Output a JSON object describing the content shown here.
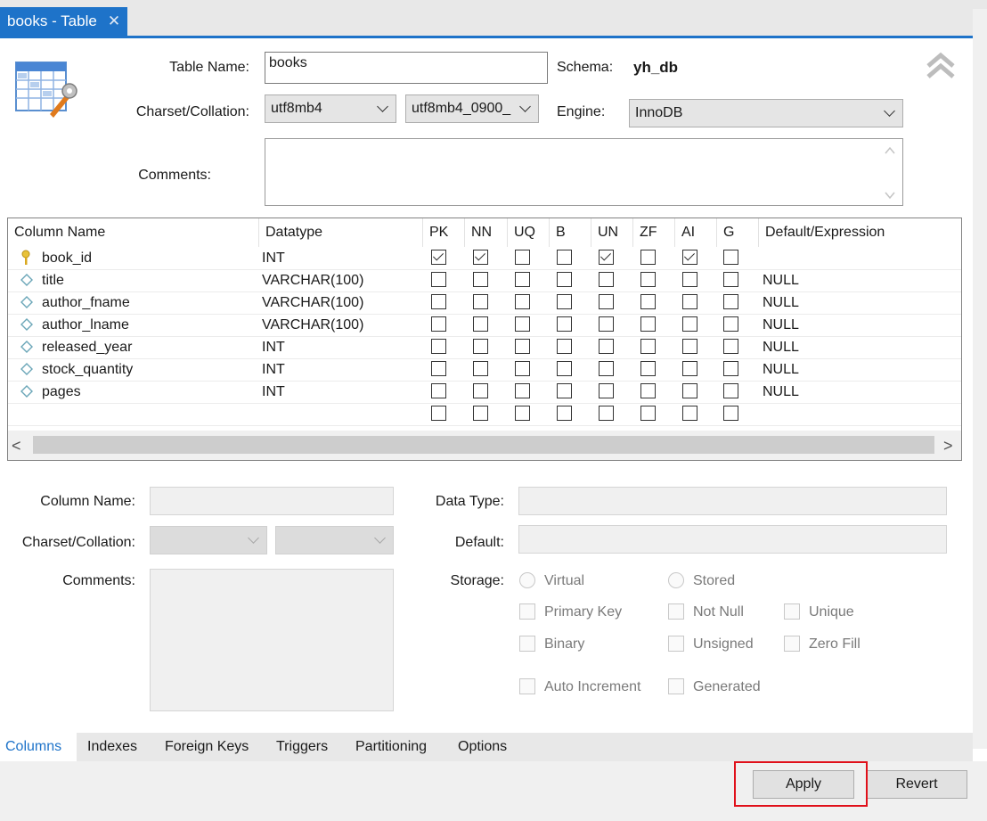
{
  "tab": {
    "title": "books - Table",
    "close_glyph": "✕"
  },
  "header": {
    "table_name_label": "Table Name:",
    "table_name_value": "books",
    "schema_label": "Schema:",
    "schema_value": "yh_db",
    "charset_label": "Charset/Collation:",
    "charset_value": "utf8mb4",
    "collation_value": "utf8mb4_0900_",
    "engine_label": "Engine:",
    "engine_value": "InnoDB",
    "comments_label": "Comments:",
    "collapse_icon": "double-chevron-up-icon",
    "table_icon": "table-wrench-icon"
  },
  "grid": {
    "headers": [
      "Column Name",
      "Datatype",
      "PK",
      "NN",
      "UQ",
      "B",
      "UN",
      "ZF",
      "AI",
      "G",
      "Default/Expression"
    ],
    "rows": [
      {
        "name": "book_id",
        "type": "INT",
        "flags": [
          true,
          true,
          false,
          false,
          true,
          false,
          true,
          false
        ],
        "default": "",
        "icon": "key-icon"
      },
      {
        "name": "title",
        "type": "VARCHAR(100)",
        "flags": [
          false,
          false,
          false,
          false,
          false,
          false,
          false,
          false
        ],
        "default": "NULL",
        "icon": "diamond-icon"
      },
      {
        "name": "author_fname",
        "type": "VARCHAR(100)",
        "flags": [
          false,
          false,
          false,
          false,
          false,
          false,
          false,
          false
        ],
        "default": "NULL",
        "icon": "diamond-icon"
      },
      {
        "name": "author_lname",
        "type": "VARCHAR(100)",
        "flags": [
          false,
          false,
          false,
          false,
          false,
          false,
          false,
          false
        ],
        "default": "NULL",
        "icon": "diamond-icon"
      },
      {
        "name": "released_year",
        "type": "INT",
        "flags": [
          false,
          false,
          false,
          false,
          false,
          false,
          false,
          false
        ],
        "default": "NULL",
        "icon": "diamond-icon"
      },
      {
        "name": "stock_quantity",
        "type": "INT",
        "flags": [
          false,
          false,
          false,
          false,
          false,
          false,
          false,
          false
        ],
        "default": "NULL",
        "icon": "diamond-icon"
      },
      {
        "name": "pages",
        "type": "INT",
        "flags": [
          false,
          false,
          false,
          false,
          false,
          false,
          false,
          false
        ],
        "default": "NULL",
        "icon": "diamond-icon"
      },
      {
        "name": "",
        "type": "",
        "flags": [
          false,
          false,
          false,
          false,
          false,
          false,
          false,
          false
        ],
        "default": "",
        "icon": ""
      }
    ],
    "scroll_left": "<",
    "scroll_right": ">"
  },
  "detail": {
    "column_name_label": "Column Name:",
    "charset_label": "Charset/Collation:",
    "comments_label": "Comments:",
    "data_type_label": "Data Type:",
    "default_label": "Default:",
    "storage_label": "Storage:",
    "virtual": "Virtual",
    "stored": "Stored",
    "primary_key": "Primary Key",
    "not_null": "Not Null",
    "unique": "Unique",
    "binary": "Binary",
    "unsigned": "Unsigned",
    "zero_fill": "Zero Fill",
    "auto_increment": "Auto Increment",
    "generated": "Generated"
  },
  "subtabs": [
    "Columns",
    "Indexes",
    "Foreign Keys",
    "Triggers",
    "Partitioning",
    "Options"
  ],
  "buttons": {
    "apply": "Apply",
    "revert": "Revert"
  },
  "colors": {
    "accent": "#1e73c9",
    "highlight": "#e0101a"
  }
}
